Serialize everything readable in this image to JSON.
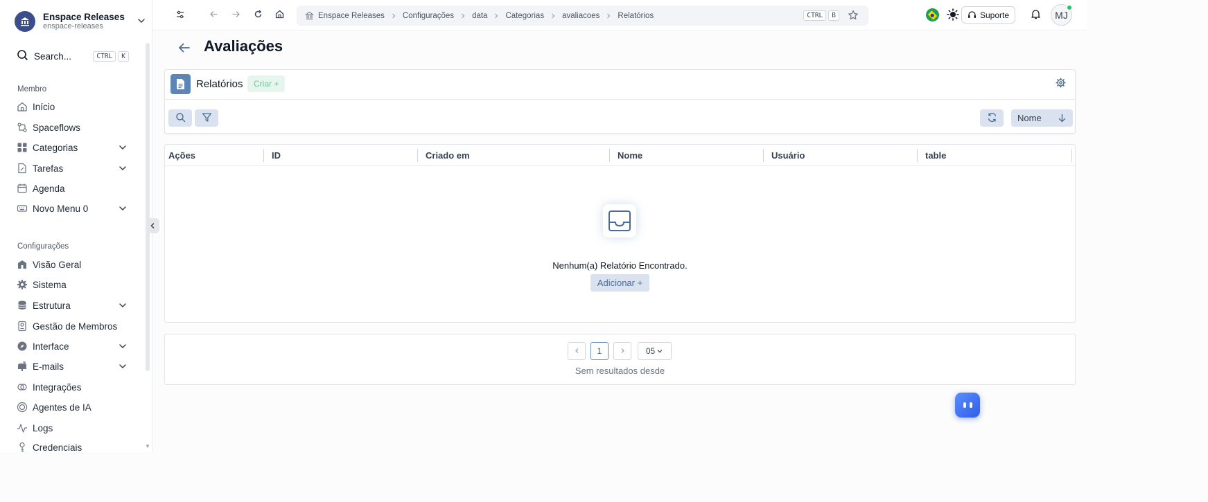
{
  "workspace": {
    "name": "Enspace Releases",
    "slug": "enspace-releases"
  },
  "search": {
    "label": "Search...",
    "kbd": [
      "CTRL",
      "K"
    ]
  },
  "sidebar": {
    "member_title": "Membro",
    "member_items": [
      {
        "label": "Início",
        "icon": "home-icon",
        "expandable": false
      },
      {
        "label": "Spaceflows",
        "icon": "flow-icon",
        "expandable": false
      },
      {
        "label": "Categorias",
        "icon": "grid-icon",
        "expandable": true
      },
      {
        "label": "Tarefas",
        "icon": "file-edit-icon",
        "expandable": true
      },
      {
        "label": "Agenda",
        "icon": "calendar-icon",
        "expandable": false
      },
      {
        "label": "Novo Menu 0",
        "icon": "keyboard-icon",
        "expandable": true
      }
    ],
    "config_title": "Configurações",
    "config_items": [
      {
        "label": "Visão Geral",
        "icon": "building-icon",
        "expandable": false
      },
      {
        "label": "Sistema",
        "icon": "gear-icon",
        "expandable": false
      },
      {
        "label": "Estrutura",
        "icon": "database-icon",
        "expandable": true
      },
      {
        "label": "Gestão de Membros",
        "icon": "id-card-icon",
        "expandable": false
      },
      {
        "label": "Interface",
        "icon": "compass-icon",
        "expandable": true
      },
      {
        "label": "E-mails",
        "icon": "mailbox-icon",
        "expandable": true
      },
      {
        "label": "Integrações",
        "icon": "plug-icon",
        "expandable": false
      },
      {
        "label": "Agentes de IA",
        "icon": "ai-icon",
        "expandable": false
      },
      {
        "label": "Logs",
        "icon": "activity-icon",
        "expandable": false
      },
      {
        "label": "Credenciais",
        "icon": "key-icon",
        "expandable": false
      }
    ]
  },
  "topbar": {
    "breadcrumbs": [
      "Enspace Releases",
      "Configurações",
      "data",
      "Categorias",
      "avaliacoes",
      "Relatórios"
    ],
    "kbd": [
      "CTRL",
      "B"
    ],
    "support_label": "Suporte",
    "avatar_initials": "MJ"
  },
  "page": {
    "title": "Avaliações"
  },
  "card": {
    "title": "Relatórios",
    "create_label": "Criar +",
    "sort_label": "Nome"
  },
  "table": {
    "columns": [
      "Ações",
      "ID",
      "Criado em",
      "Nome",
      "Usuário",
      "table"
    ],
    "empty_text": "Nenhum(a) Relatório Encontrado.",
    "add_label": "Adicionar +"
  },
  "pagination": {
    "current_page": "1",
    "page_size": "05",
    "status_text": "Sem resultados desde"
  },
  "colors": {
    "accent": "#5b86b5",
    "create_green": "#6fc79b",
    "button_bg": "#d9e2ee",
    "bot_blue": "#3b6ef5"
  }
}
